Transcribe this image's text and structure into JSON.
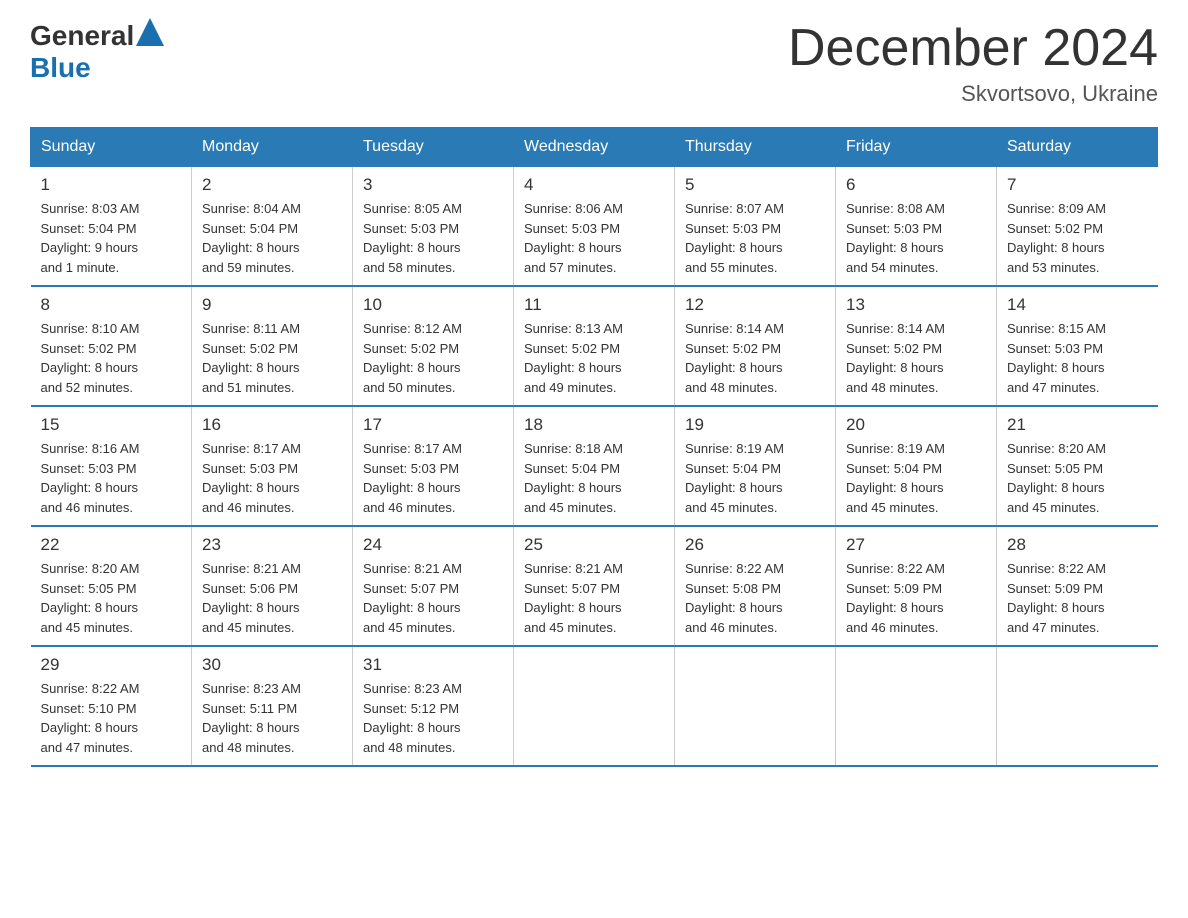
{
  "header": {
    "logo_general": "General",
    "logo_blue": "Blue",
    "month_title": "December 2024",
    "location": "Skvortsovo, Ukraine"
  },
  "weekdays": [
    "Sunday",
    "Monday",
    "Tuesday",
    "Wednesday",
    "Thursday",
    "Friday",
    "Saturday"
  ],
  "weeks": [
    [
      {
        "day": "1",
        "info": "Sunrise: 8:03 AM\nSunset: 5:04 PM\nDaylight: 9 hours\nand 1 minute."
      },
      {
        "day": "2",
        "info": "Sunrise: 8:04 AM\nSunset: 5:04 PM\nDaylight: 8 hours\nand 59 minutes."
      },
      {
        "day": "3",
        "info": "Sunrise: 8:05 AM\nSunset: 5:03 PM\nDaylight: 8 hours\nand 58 minutes."
      },
      {
        "day": "4",
        "info": "Sunrise: 8:06 AM\nSunset: 5:03 PM\nDaylight: 8 hours\nand 57 minutes."
      },
      {
        "day": "5",
        "info": "Sunrise: 8:07 AM\nSunset: 5:03 PM\nDaylight: 8 hours\nand 55 minutes."
      },
      {
        "day": "6",
        "info": "Sunrise: 8:08 AM\nSunset: 5:03 PM\nDaylight: 8 hours\nand 54 minutes."
      },
      {
        "day": "7",
        "info": "Sunrise: 8:09 AM\nSunset: 5:02 PM\nDaylight: 8 hours\nand 53 minutes."
      }
    ],
    [
      {
        "day": "8",
        "info": "Sunrise: 8:10 AM\nSunset: 5:02 PM\nDaylight: 8 hours\nand 52 minutes."
      },
      {
        "day": "9",
        "info": "Sunrise: 8:11 AM\nSunset: 5:02 PM\nDaylight: 8 hours\nand 51 minutes."
      },
      {
        "day": "10",
        "info": "Sunrise: 8:12 AM\nSunset: 5:02 PM\nDaylight: 8 hours\nand 50 minutes."
      },
      {
        "day": "11",
        "info": "Sunrise: 8:13 AM\nSunset: 5:02 PM\nDaylight: 8 hours\nand 49 minutes."
      },
      {
        "day": "12",
        "info": "Sunrise: 8:14 AM\nSunset: 5:02 PM\nDaylight: 8 hours\nand 48 minutes."
      },
      {
        "day": "13",
        "info": "Sunrise: 8:14 AM\nSunset: 5:02 PM\nDaylight: 8 hours\nand 48 minutes."
      },
      {
        "day": "14",
        "info": "Sunrise: 8:15 AM\nSunset: 5:03 PM\nDaylight: 8 hours\nand 47 minutes."
      }
    ],
    [
      {
        "day": "15",
        "info": "Sunrise: 8:16 AM\nSunset: 5:03 PM\nDaylight: 8 hours\nand 46 minutes."
      },
      {
        "day": "16",
        "info": "Sunrise: 8:17 AM\nSunset: 5:03 PM\nDaylight: 8 hours\nand 46 minutes."
      },
      {
        "day": "17",
        "info": "Sunrise: 8:17 AM\nSunset: 5:03 PM\nDaylight: 8 hours\nand 46 minutes."
      },
      {
        "day": "18",
        "info": "Sunrise: 8:18 AM\nSunset: 5:04 PM\nDaylight: 8 hours\nand 45 minutes."
      },
      {
        "day": "19",
        "info": "Sunrise: 8:19 AM\nSunset: 5:04 PM\nDaylight: 8 hours\nand 45 minutes."
      },
      {
        "day": "20",
        "info": "Sunrise: 8:19 AM\nSunset: 5:04 PM\nDaylight: 8 hours\nand 45 minutes."
      },
      {
        "day": "21",
        "info": "Sunrise: 8:20 AM\nSunset: 5:05 PM\nDaylight: 8 hours\nand 45 minutes."
      }
    ],
    [
      {
        "day": "22",
        "info": "Sunrise: 8:20 AM\nSunset: 5:05 PM\nDaylight: 8 hours\nand 45 minutes."
      },
      {
        "day": "23",
        "info": "Sunrise: 8:21 AM\nSunset: 5:06 PM\nDaylight: 8 hours\nand 45 minutes."
      },
      {
        "day": "24",
        "info": "Sunrise: 8:21 AM\nSunset: 5:07 PM\nDaylight: 8 hours\nand 45 minutes."
      },
      {
        "day": "25",
        "info": "Sunrise: 8:21 AM\nSunset: 5:07 PM\nDaylight: 8 hours\nand 45 minutes."
      },
      {
        "day": "26",
        "info": "Sunrise: 8:22 AM\nSunset: 5:08 PM\nDaylight: 8 hours\nand 46 minutes."
      },
      {
        "day": "27",
        "info": "Sunrise: 8:22 AM\nSunset: 5:09 PM\nDaylight: 8 hours\nand 46 minutes."
      },
      {
        "day": "28",
        "info": "Sunrise: 8:22 AM\nSunset: 5:09 PM\nDaylight: 8 hours\nand 47 minutes."
      }
    ],
    [
      {
        "day": "29",
        "info": "Sunrise: 8:22 AM\nSunset: 5:10 PM\nDaylight: 8 hours\nand 47 minutes."
      },
      {
        "day": "30",
        "info": "Sunrise: 8:23 AM\nSunset: 5:11 PM\nDaylight: 8 hours\nand 48 minutes."
      },
      {
        "day": "31",
        "info": "Sunrise: 8:23 AM\nSunset: 5:12 PM\nDaylight: 8 hours\nand 48 minutes."
      },
      {
        "day": "",
        "info": ""
      },
      {
        "day": "",
        "info": ""
      },
      {
        "day": "",
        "info": ""
      },
      {
        "day": "",
        "info": ""
      }
    ]
  ]
}
